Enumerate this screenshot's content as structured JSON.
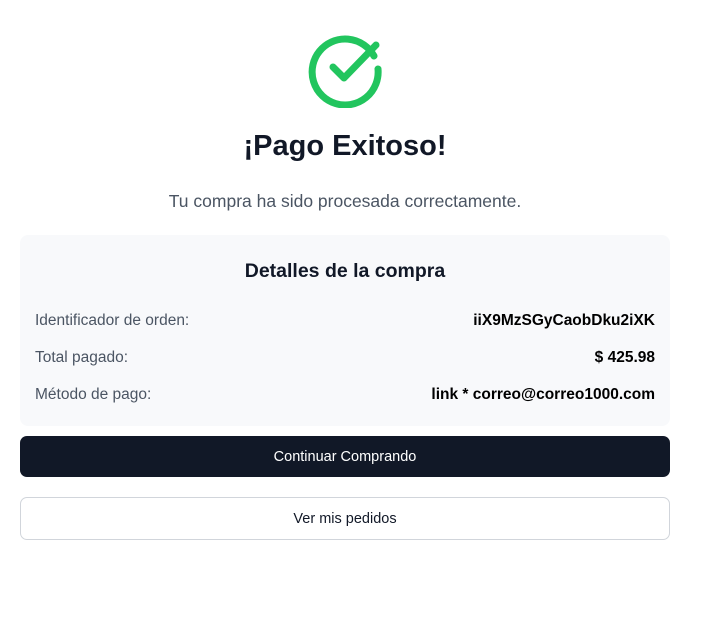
{
  "status": {
    "icon": "check-circle-icon",
    "color": "#22c55e",
    "title": "¡Pago Exitoso!",
    "subtitle": "Tu compra ha sido procesada correctamente."
  },
  "details": {
    "title": "Detalles de la compra",
    "rows": [
      {
        "label": "Identificador de orden:",
        "value": "iiX9MzSGyCaobDku2iXK"
      },
      {
        "label": "Total pagado:",
        "value": "$ 425.98"
      },
      {
        "label": "Método de pago:",
        "value": "link * correo@correo1000.com"
      }
    ]
  },
  "actions": {
    "continue_label": "Continuar Comprando",
    "orders_label": "Ver mis pedidos"
  },
  "colors": {
    "primary_button": "#111827",
    "panel_background": "#f8f9fb",
    "success": "#22c55e"
  }
}
